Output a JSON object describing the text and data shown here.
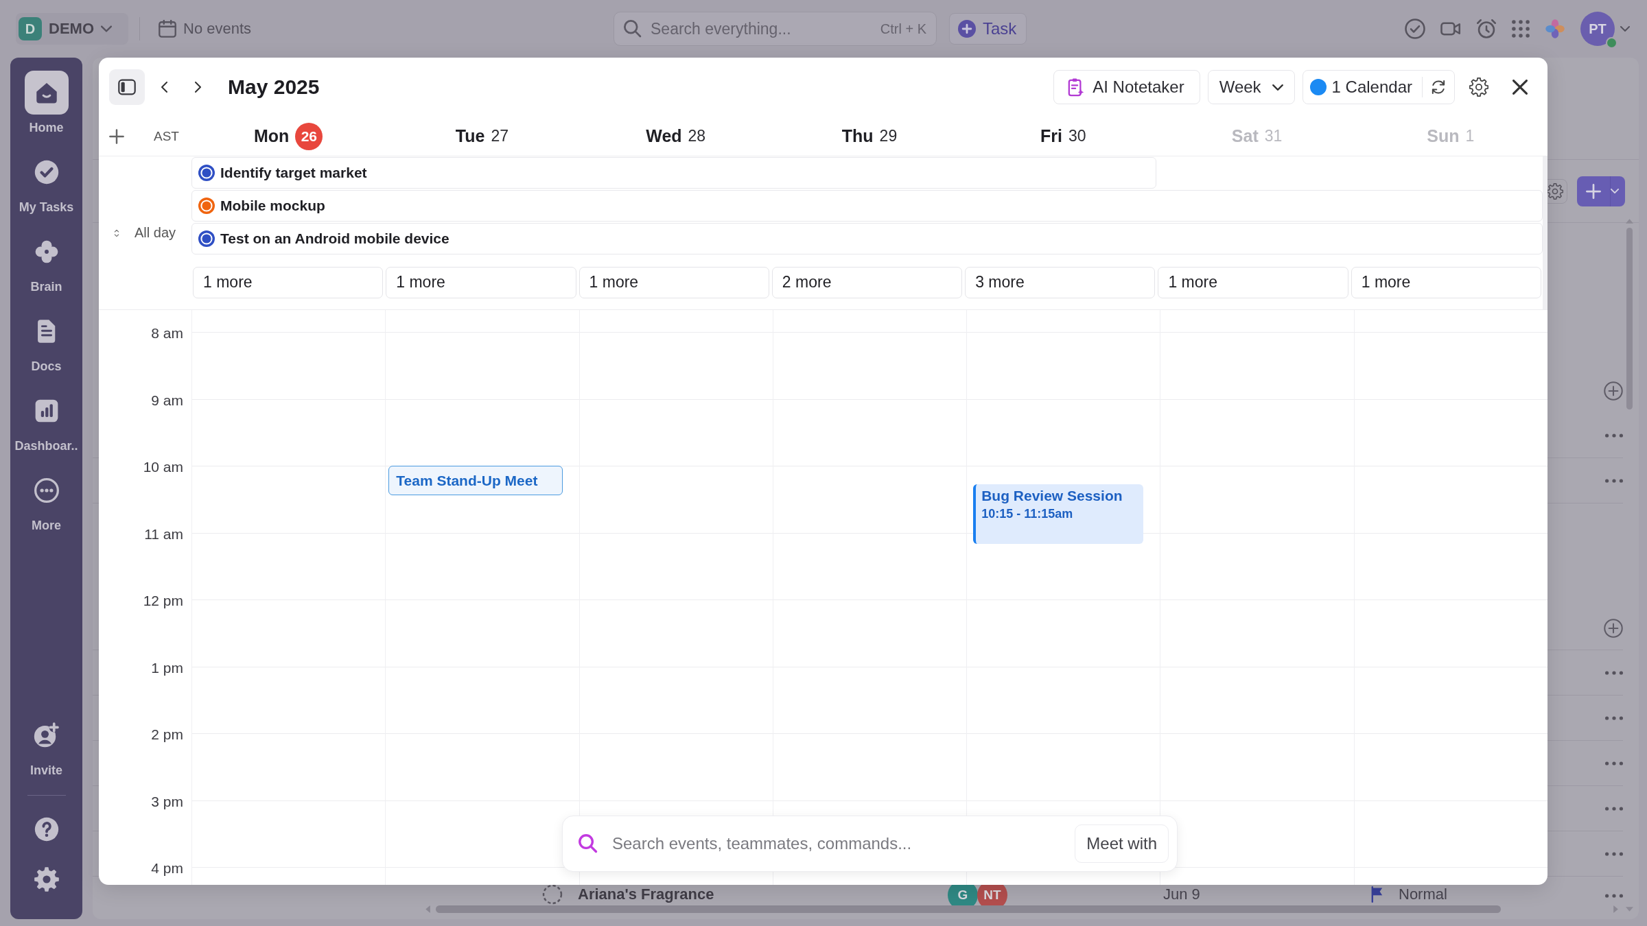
{
  "top_bar": {
    "workspace_initial": "D",
    "workspace_name": "DEMO",
    "events_status": "No events",
    "search": {
      "placeholder": "Search everything...",
      "shortcut": "Ctrl + K"
    },
    "task_button": "Task",
    "avatar": {
      "initials": "PT",
      "online": true
    }
  },
  "sidebar": {
    "items": [
      {
        "label": "Home",
        "selected": true
      },
      {
        "label": "My Tasks",
        "selected": false
      },
      {
        "label": "Brain",
        "selected": false
      },
      {
        "label": "Docs",
        "selected": false
      },
      {
        "label": "Dashboar..",
        "selected": false
      },
      {
        "label": "More",
        "selected": false
      }
    ],
    "invite": "Invite"
  },
  "background_list": {
    "rows": [
      {
        "name": "Ariana's Fragrance",
        "assignees": [
          {
            "initials": "G",
            "color": "#2f8984"
          },
          {
            "initials": "NT",
            "color": "#b34e4e"
          }
        ],
        "due": "Jun 9",
        "priority": "Normal"
      }
    ]
  },
  "calendar": {
    "title": "May 2025",
    "buttons": {
      "notetaker": "AI Notetaker",
      "view": "Week",
      "calendars": "1 Calendar"
    },
    "timezone": "AST",
    "all_day_label": "All day",
    "days": [
      {
        "name": "Mon",
        "date": "26",
        "today": true,
        "weekend": false,
        "more": "1 more"
      },
      {
        "name": "Tue",
        "date": "27",
        "today": false,
        "weekend": false,
        "more": "1 more",
        "events": [
          {
            "kind": "chip",
            "title": "Team Stand-Up Meet"
          }
        ]
      },
      {
        "name": "Wed",
        "date": "28",
        "today": false,
        "weekend": false,
        "more": "1 more"
      },
      {
        "name": "Thu",
        "date": "29",
        "today": false,
        "weekend": false,
        "more": "2 more"
      },
      {
        "name": "Fri",
        "date": "30",
        "today": false,
        "weekend": false,
        "more": "3 more",
        "events": [
          {
            "kind": "block",
            "title": "Bug Review Session",
            "time": "10:15 - 11:15am"
          }
        ]
      },
      {
        "name": "Sat",
        "date": "31",
        "today": false,
        "weekend": true,
        "more": "1 more"
      },
      {
        "name": "Sun",
        "date": "1",
        "today": false,
        "weekend": true,
        "more": "1 more"
      }
    ],
    "all_day_events": [
      {
        "title": "Identify target market",
        "color": "#2f4fc4",
        "includes_weekend": false
      },
      {
        "title": "Mobile mockup",
        "color": "#f0640f",
        "includes_weekend": true
      },
      {
        "title": "Test on an Android mobile device",
        "color": "#2f4fc4",
        "includes_weekend": true
      }
    ],
    "hours": [
      "8 am",
      "9 am",
      "10 am",
      "11 am",
      "12 pm",
      "1 pm",
      "2 pm",
      "3 pm",
      "4 pm"
    ],
    "search": {
      "placeholder": "Search events, teammates, commands...",
      "button": "Meet with"
    }
  }
}
